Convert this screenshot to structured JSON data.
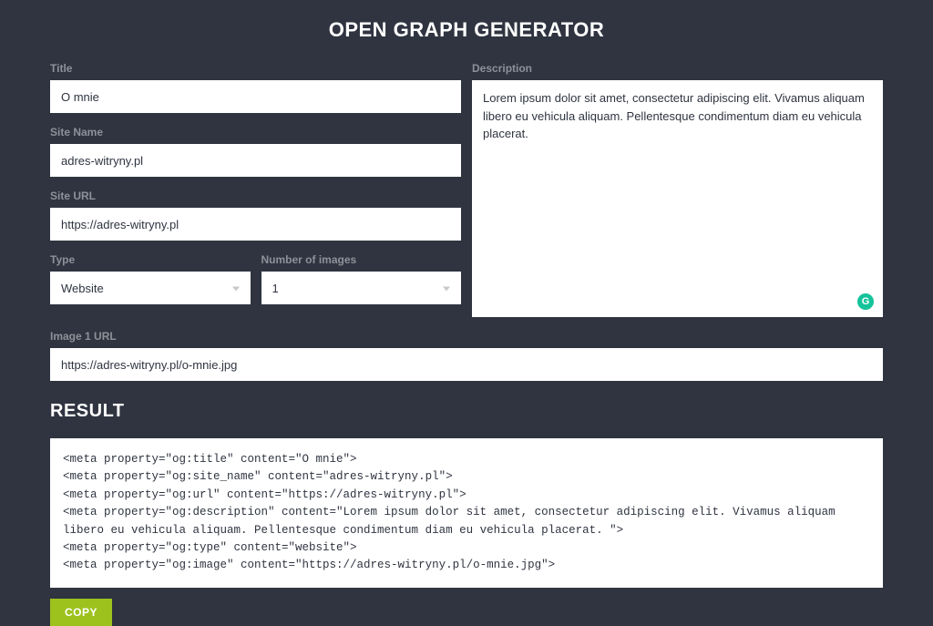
{
  "header": {
    "title": "OPEN GRAPH GENERATOR"
  },
  "form": {
    "title": {
      "label": "Title",
      "value": "O mnie"
    },
    "siteName": {
      "label": "Site Name",
      "value": "adres-witryny.pl"
    },
    "siteUrl": {
      "label": "Site URL",
      "value": "https://adres-witryny.pl"
    },
    "type": {
      "label": "Type",
      "selected": "Website"
    },
    "numImages": {
      "label": "Number of images",
      "selected": "1"
    },
    "description": {
      "label": "Description",
      "value": "Lorem ipsum dolor sit amet, consectetur adipiscing elit. Vivamus aliquam libero eu vehicula aliquam. Pellentesque condimentum diam eu vehicula placerat."
    },
    "image1": {
      "label": "Image 1 URL",
      "value": "https://adres-witryny.pl/o-mnie.jpg"
    }
  },
  "result": {
    "heading": "RESULT",
    "code": "<meta property=\"og:title\" content=\"O mnie\">\n<meta property=\"og:site_name\" content=\"adres-witryny.pl\">\n<meta property=\"og:url\" content=\"https://adres-witryny.pl\">\n<meta property=\"og:description\" content=\"Lorem ipsum dolor sit amet, consectetur adipiscing elit. Vivamus aliquam libero eu vehicula aliquam. Pellentesque condimentum diam eu vehicula placerat. \">\n<meta property=\"og:type\" content=\"website\">\n<meta property=\"og:image\" content=\"https://adres-witryny.pl/o-mnie.jpg\">",
    "copyLabel": "COPY"
  },
  "icons": {
    "grammarly": "G"
  }
}
